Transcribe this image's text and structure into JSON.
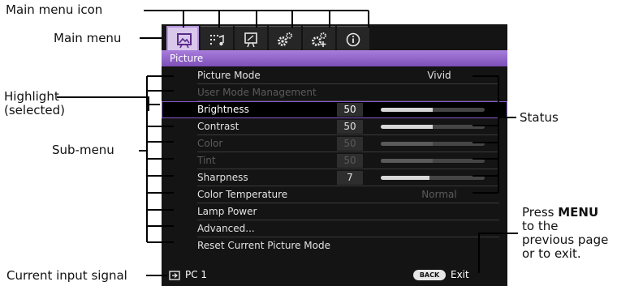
{
  "annotations": {
    "main_menu_icon": "Main menu icon",
    "main_menu": "Main menu",
    "highlight_line1": "Highlight",
    "highlight_line2": "(selected)",
    "sub_menu": "Sub-menu",
    "current_input_signal": "Current input signal",
    "status": "Status",
    "press_prefix": "Press ",
    "press_key": "MENU",
    "press_line2": "to the",
    "press_line3": "previous page",
    "press_line4": "or to exit."
  },
  "osd": {
    "tabs": [
      {
        "icon": "picture-icon",
        "active": true
      },
      {
        "icon": "audio-display-icon",
        "active": false
      },
      {
        "icon": "installation-icon",
        "active": false
      },
      {
        "icon": "basic-settings-icon",
        "active": false
      },
      {
        "icon": "advanced-settings-icon",
        "active": false
      },
      {
        "icon": "information-icon",
        "active": false
      }
    ],
    "title": "Picture",
    "rows": [
      {
        "label": "Picture Mode",
        "text_status": "Vivid",
        "dim": false
      },
      {
        "label": "User Mode Management",
        "dim": true
      },
      {
        "label": "Brightness",
        "value": "50",
        "level": 0.5,
        "selected": true
      },
      {
        "label": "Contrast",
        "value": "50",
        "level": 0.5
      },
      {
        "label": "Color",
        "value": "50",
        "level": 0.5,
        "dim": true
      },
      {
        "label": "Tint",
        "value": "50",
        "level": 0.5,
        "dim": true
      },
      {
        "label": "Sharpness",
        "value": "7",
        "level": 0.47
      },
      {
        "label": "Color Temperature",
        "text_status": "Normal",
        "status_dim": true
      },
      {
        "label": "Lamp Power"
      },
      {
        "label": "Advanced..."
      },
      {
        "label": "Reset Current Picture Mode"
      }
    ],
    "input_signal": "PC 1",
    "back_key": "BACK",
    "exit_label": "Exit"
  },
  "colors": {
    "accent": "#8a5bd0",
    "title_bar": "#9a6fd0",
    "osd_background": "#141414"
  }
}
